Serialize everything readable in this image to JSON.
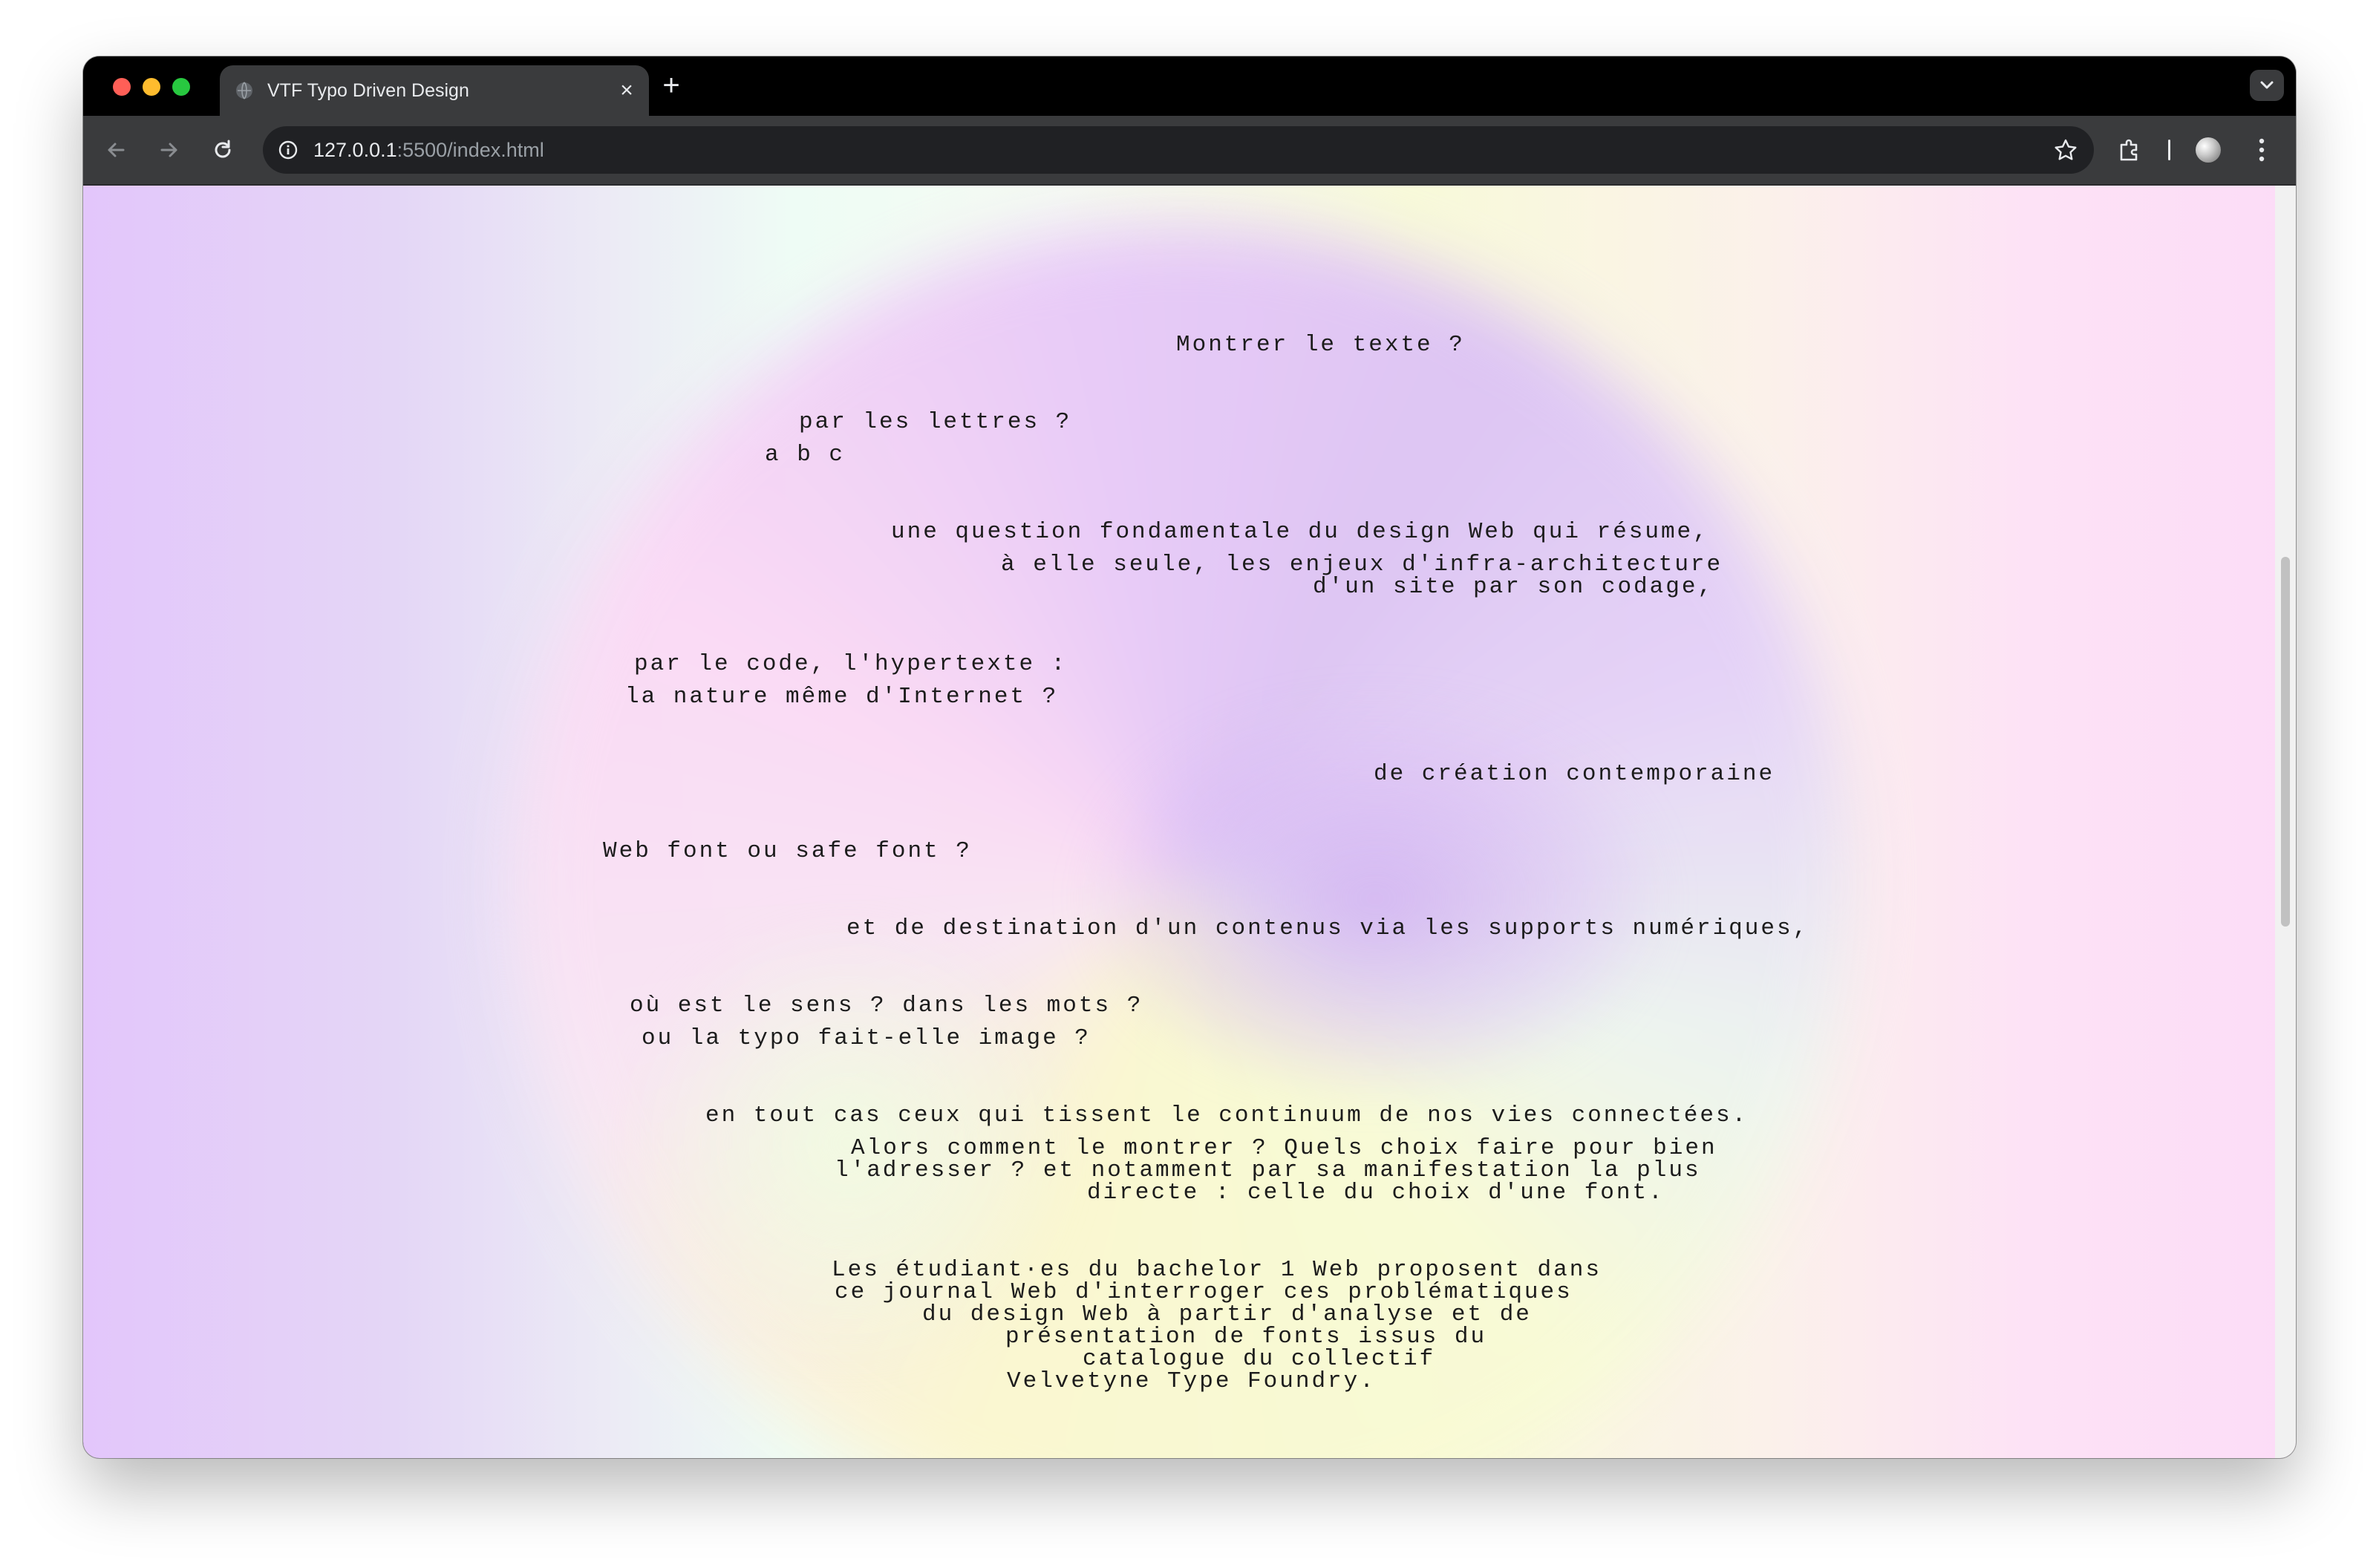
{
  "browser": {
    "tab_title": "VTF Typo Driven Design",
    "new_tab_label": "+",
    "url_host": "127.0.0.1",
    "url_path": ":5500/index.html"
  },
  "page": {
    "lines": {
      "l1": "Montrer le texte ?",
      "l2": "par les lettres ?",
      "l3": "a b c",
      "l4": "une question fondamentale du design Web qui résume,",
      "l5a": "à elle seule, les enjeux d'infra-architecture",
      "l5b": "d'un site par son codage,",
      "l6a": "par le code, l'hypertexte :",
      "l6b": "la nature même d'Internet ?",
      "l7": "de création contemporaine",
      "l8": "Web font ou safe font ?",
      "l9": "et de destination d'un contenus via les supports numériques,",
      "l10a": "où est le sens ? dans les mots ?",
      "l10b": "ou la typo fait-elle image ?",
      "l11": "en tout cas ceux qui tissent le continuum de nos vies connectées.",
      "l12a": "Alors comment le montrer ? Quels choix faire pour bien",
      "l12b": "l'adresser ? et notamment par sa manifestation la plus",
      "l12c": "directe : celle du choix d'une font.",
      "l13a": "Les étudiant·es du bachelor 1 Web proposent dans",
      "l13b": "ce journal Web d'interroger ces problématiques",
      "l13c": "du design Web à partir d'analyse et de",
      "l13d": "présentation de fonts issus du",
      "l13e": "catalogue du collectif",
      "l13f": "Velvetyne Type Foundry."
    }
  }
}
